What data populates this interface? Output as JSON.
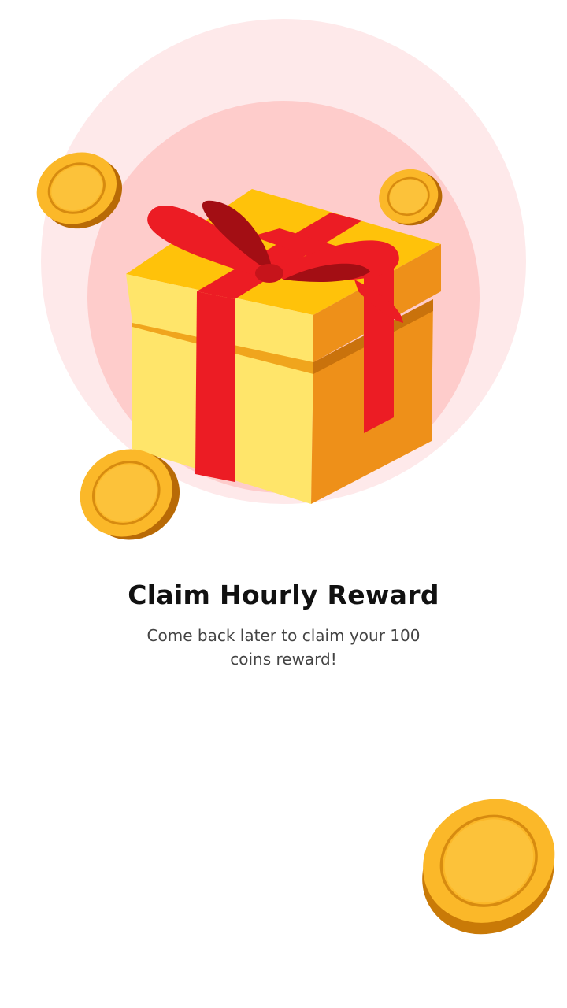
{
  "reward": {
    "title": "Claim Hourly Reward",
    "message": "Come back later to claim your 100 coins reward!"
  },
  "illustration": {
    "main_icon": "gift-box-icon",
    "decorations": [
      "coin-icon",
      "coin-icon",
      "coin-icon",
      "coin-icon"
    ],
    "colors": {
      "outer_ring": "#fee9ea",
      "inner_ring": "#fecccb",
      "box_yellow": "#ffe56a",
      "box_orange": "#ee9019",
      "ribbon_red": "#ec1c24",
      "coin_gold": "#fbb829"
    }
  }
}
